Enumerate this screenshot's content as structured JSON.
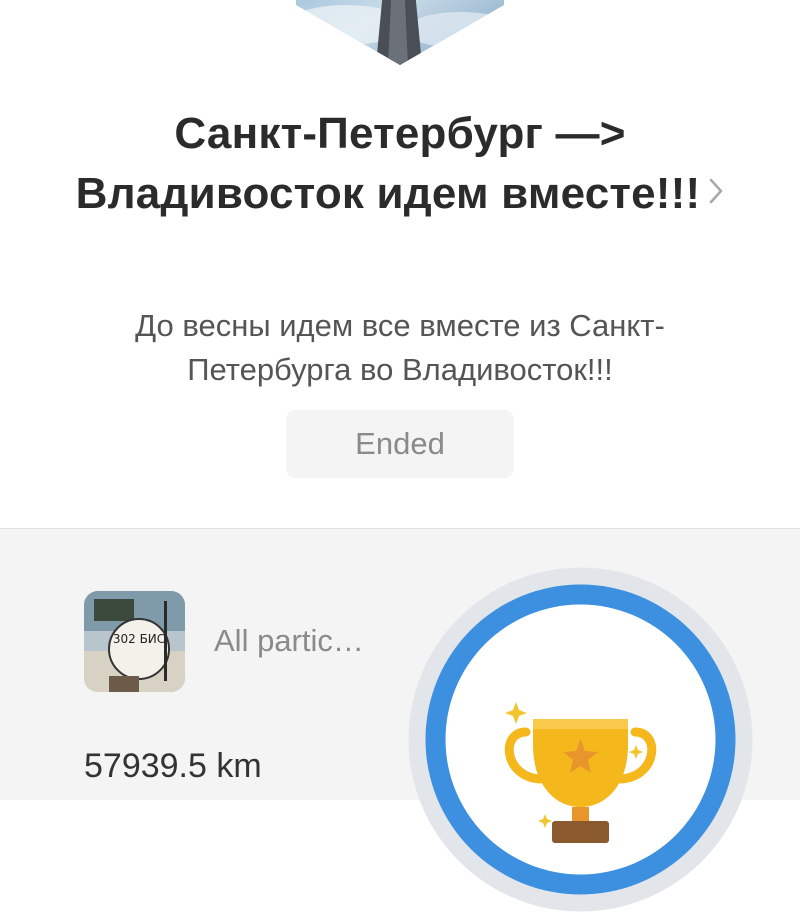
{
  "challenge": {
    "title": "Санкт-Петербург —> Владивосток идем вместе!!!",
    "description": "До весны идем все вместе из Санкт-Петербурга во Владивосток!!!",
    "status": "Ended"
  },
  "participants": {
    "label": "All partic…"
  },
  "stats": {
    "distance": "57939.5 km"
  },
  "avatar_sign_text": "302 БИС",
  "colors": {
    "ring": "#3d8fe0",
    "trophy": "#f5b81c",
    "sparkle": "#f2c531",
    "background": "#f4f4f4"
  },
  "icons": {
    "chevron": "chevron-right-icon",
    "trophy": "trophy-icon"
  }
}
